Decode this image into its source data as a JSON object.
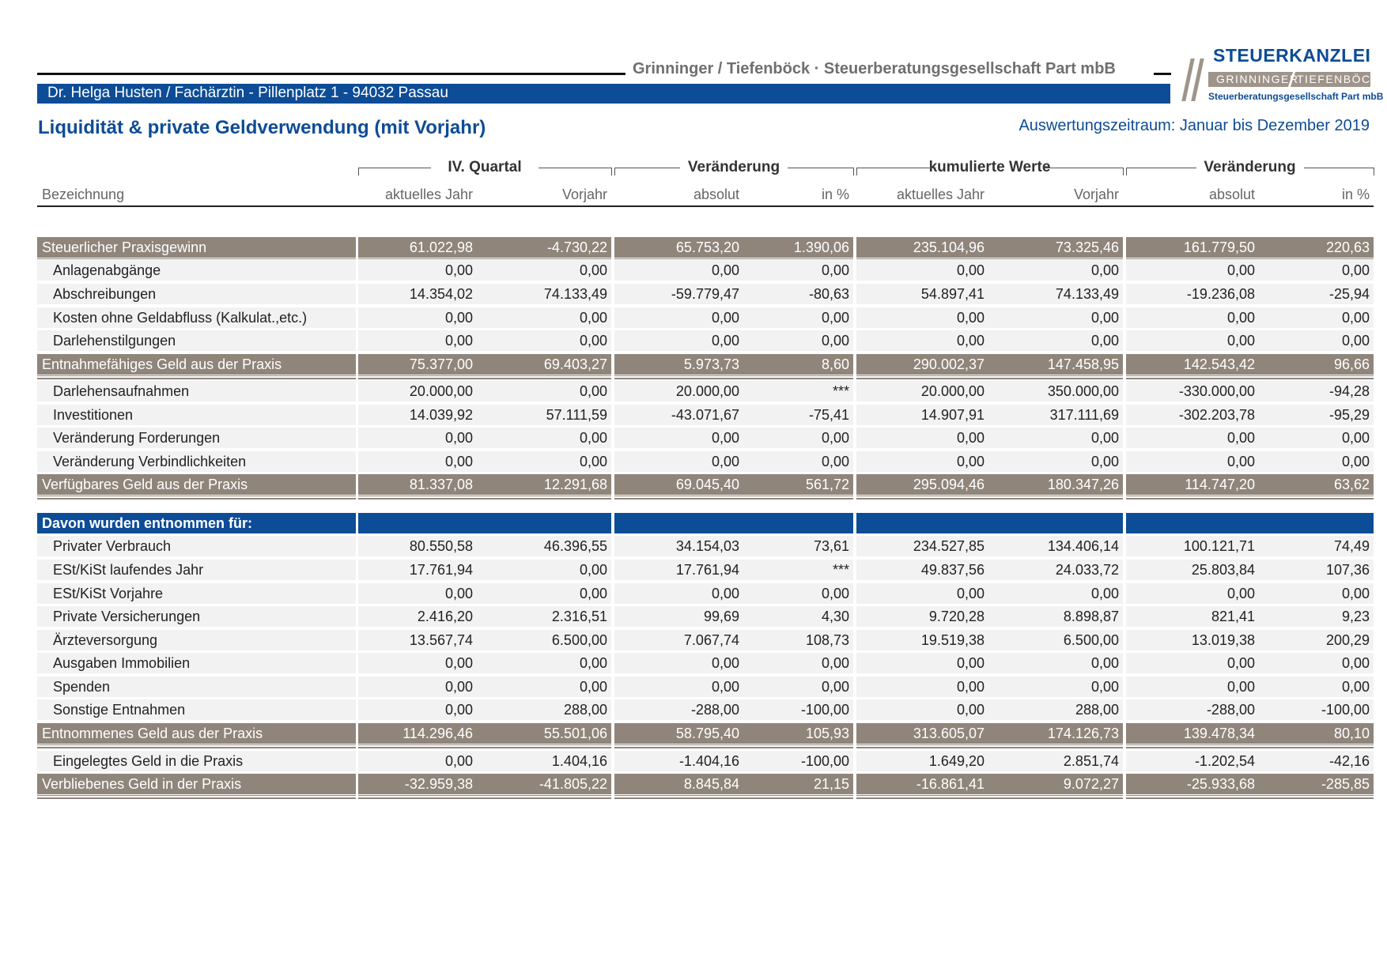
{
  "header": {
    "firm": "Grinninger / Tiefenböck · Steuerberatungsgesellschaft Part mbB",
    "client": "Dr. Helga Husten / Fachärztin  -  Pillenplatz 1  -  94032 Passau",
    "title": "Liquidität & private Geldverwendung (mit Vorjahr)",
    "period": "Auswertungszeitraum: Januar bis Dezember 2019"
  },
  "logo": {
    "brand": "STEUERKANZLEI",
    "band_left": "GRINNINGER",
    "band_right": "TIEFENBÖCK",
    "sub": "Steuerberatungsgesellschaft Part mbB"
  },
  "column_groups": [
    "IV. Quartal",
    "Veränderung",
    "kumulierte Werte",
    "Veränderung"
  ],
  "columns": [
    "Bezeichnung",
    "aktuelles Jahr",
    "Vorjahr",
    "absolut",
    "in %",
    "aktuelles Jahr",
    "Vorjahr",
    "absolut",
    "in %"
  ],
  "rows": [
    {
      "type": "sum",
      "label": "Steuerlicher Praxisgewinn",
      "values": [
        "61.022,98",
        "-4.730,22",
        "65.753,20",
        "1.390,06",
        "235.104,96",
        "73.325,46",
        "161.779,50",
        "220,63"
      ]
    },
    {
      "type": "item",
      "label": "Anlagenabgänge",
      "values": [
        "0,00",
        "0,00",
        "0,00",
        "0,00",
        "0,00",
        "0,00",
        "0,00",
        "0,00"
      ]
    },
    {
      "type": "item",
      "label": "Abschreibungen",
      "values": [
        "14.354,02",
        "74.133,49",
        "-59.779,47",
        "-80,63",
        "54.897,41",
        "74.133,49",
        "-19.236,08",
        "-25,94"
      ]
    },
    {
      "type": "item",
      "label": "Kosten ohne Geldabfluss (Kalkulat.,etc.)",
      "values": [
        "0,00",
        "0,00",
        "0,00",
        "0,00",
        "0,00",
        "0,00",
        "0,00",
        "0,00"
      ]
    },
    {
      "type": "item",
      "label": "Darlehenstilgungen",
      "values": [
        "0,00",
        "0,00",
        "0,00",
        "0,00",
        "0,00",
        "0,00",
        "0,00",
        "0,00"
      ]
    },
    {
      "type": "sum",
      "label": "Entnahmefähiges Geld aus der Praxis",
      "values": [
        "75.377,00",
        "69.403,27",
        "5.973,73",
        "8,60",
        "290.002,37",
        "147.458,95",
        "142.543,42",
        "96,66"
      ]
    },
    {
      "type": "item",
      "label": "Darlehensaufnahmen",
      "values": [
        "20.000,00",
        "0,00",
        "20.000,00",
        "***",
        "20.000,00",
        "350.000,00",
        "-330.000,00",
        "-94,28"
      ]
    },
    {
      "type": "item",
      "label": "Investitionen",
      "values": [
        "14.039,92",
        "57.111,59",
        "-43.071,67",
        "-75,41",
        "14.907,91",
        "317.111,69",
        "-302.203,78",
        "-95,29"
      ]
    },
    {
      "type": "item",
      "label": "Veränderung Forderungen",
      "values": [
        "0,00",
        "0,00",
        "0,00",
        "0,00",
        "0,00",
        "0,00",
        "0,00",
        "0,00"
      ]
    },
    {
      "type": "item",
      "label": "Veränderung Verbindlichkeiten",
      "values": [
        "0,00",
        "0,00",
        "0,00",
        "0,00",
        "0,00",
        "0,00",
        "0,00",
        "0,00"
      ]
    },
    {
      "type": "sum",
      "label": "Verfügbares Geld aus der Praxis",
      "values": [
        "81.337,08",
        "12.291,68",
        "69.045,40",
        "561,72",
        "295.094,46",
        "180.347,26",
        "114.747,20",
        "63,62"
      ]
    },
    {
      "type": "sec",
      "label": "Davon wurden entnommen für:",
      "values": [
        "",
        "",
        "",
        "",
        "",
        "",
        "",
        ""
      ]
    },
    {
      "type": "item",
      "label": "Privater Verbrauch",
      "values": [
        "80.550,58",
        "46.396,55",
        "34.154,03",
        "73,61",
        "234.527,85",
        "134.406,14",
        "100.121,71",
        "74,49"
      ]
    },
    {
      "type": "item",
      "label": "ESt/KiSt laufendes Jahr",
      "values": [
        "17.761,94",
        "0,00",
        "17.761,94",
        "***",
        "49.837,56",
        "24.033,72",
        "25.803,84",
        "107,36"
      ]
    },
    {
      "type": "item",
      "label": "ESt/KiSt Vorjahre",
      "values": [
        "0,00",
        "0,00",
        "0,00",
        "0,00",
        "0,00",
        "0,00",
        "0,00",
        "0,00"
      ]
    },
    {
      "type": "item",
      "label": "Private Versicherungen",
      "values": [
        "2.416,20",
        "2.316,51",
        "99,69",
        "4,30",
        "9.720,28",
        "8.898,87",
        "821,41",
        "9,23"
      ]
    },
    {
      "type": "item",
      "label": "Ärzteversorgung",
      "values": [
        "13.567,74",
        "6.500,00",
        "7.067,74",
        "108,73",
        "19.519,38",
        "6.500,00",
        "13.019,38",
        "200,29"
      ]
    },
    {
      "type": "item",
      "label": "Ausgaben Immobilien",
      "values": [
        "0,00",
        "0,00",
        "0,00",
        "0,00",
        "0,00",
        "0,00",
        "0,00",
        "0,00"
      ]
    },
    {
      "type": "item",
      "label": "Spenden",
      "values": [
        "0,00",
        "0,00",
        "0,00",
        "0,00",
        "0,00",
        "0,00",
        "0,00",
        "0,00"
      ]
    },
    {
      "type": "item",
      "label": "Sonstige Entnahmen",
      "values": [
        "0,00",
        "288,00",
        "-288,00",
        "-100,00",
        "0,00",
        "288,00",
        "-288,00",
        "-100,00"
      ]
    },
    {
      "type": "sum",
      "label": "Entnommenes Geld aus der Praxis",
      "values": [
        "114.296,46",
        "55.501,06",
        "58.795,40",
        "105,93",
        "313.605,07",
        "174.126,73",
        "139.478,34",
        "80,10"
      ]
    },
    {
      "type": "item",
      "label": "Eingelegtes Geld in die Praxis",
      "values": [
        "0,00",
        "1.404,16",
        "-1.404,16",
        "-100,00",
        "1.649,20",
        "2.851,74",
        "-1.202,54",
        "-42,16"
      ]
    },
    {
      "type": "sum",
      "label": "Verbliebenes Geld in der Praxis",
      "values": [
        "-32.959,38",
        "-41.805,22",
        "8.845,84",
        "21,15",
        "-16.861,41",
        "9.072,27",
        "-25.933,68",
        "-285,85"
      ]
    }
  ]
}
